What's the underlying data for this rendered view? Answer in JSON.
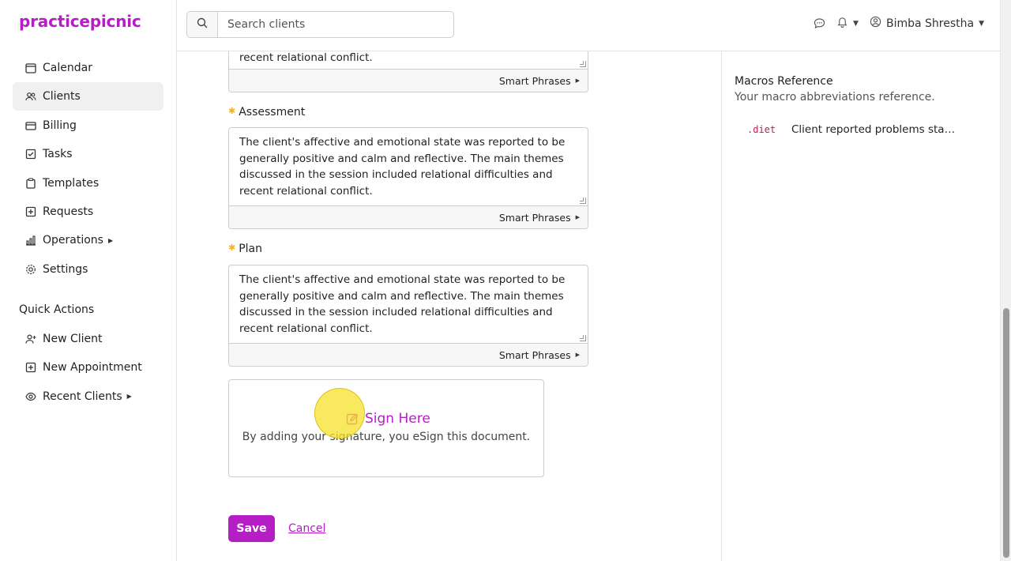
{
  "app": {
    "logo": "practicepicnic",
    "accent": "#b41ec4"
  },
  "sidebar": {
    "items": [
      {
        "label": "Calendar",
        "icon": "calendar-icon"
      },
      {
        "label": "Clients",
        "icon": "users-icon",
        "active": true
      },
      {
        "label": "Billing",
        "icon": "credit-card-icon"
      },
      {
        "label": "Tasks",
        "icon": "checkbox-icon"
      },
      {
        "label": "Templates",
        "icon": "clipboard-icon"
      },
      {
        "label": "Requests",
        "icon": "plus-square-icon"
      },
      {
        "label": "Operations",
        "icon": "bar-chart-icon",
        "has_submenu": true
      },
      {
        "label": "Settings",
        "icon": "gear-icon"
      }
    ],
    "quick_actions_title": "Quick Actions",
    "quick_actions": [
      {
        "label": "New Client",
        "icon": "user-plus-icon"
      },
      {
        "label": "New Appointment",
        "icon": "calendar-plus-icon"
      },
      {
        "label": "Recent Clients",
        "icon": "eye-icon",
        "has_submenu": true
      }
    ]
  },
  "header": {
    "search_placeholder": "Search clients",
    "user_name": "Bimba Shrestha"
  },
  "form": {
    "prev_text_tail": "recent relational conflict.",
    "smart_phrases_label": "Smart Phrases",
    "assessment": {
      "label": "Assessment",
      "text": "The client's affective and emotional state was reported to be generally positive and calm and reflective. The main themes discussed in the session included relational difficulties and recent relational conflict."
    },
    "plan": {
      "label": "Plan",
      "text": "The client's affective and emotional state was reported to be generally positive and calm and reflective. The main themes discussed in the session included relational difficulties and recent relational conflict."
    },
    "signature": {
      "title": "Sign Here",
      "description": "By adding your signature, you eSign this document."
    },
    "save_label": "Save",
    "cancel_label": "Cancel"
  },
  "macros": {
    "title": "Macros Reference",
    "subtitle": "Your macro abbreviations reference.",
    "items": [
      {
        "code": ".diet",
        "text": "Client reported problems stayi..."
      }
    ]
  }
}
